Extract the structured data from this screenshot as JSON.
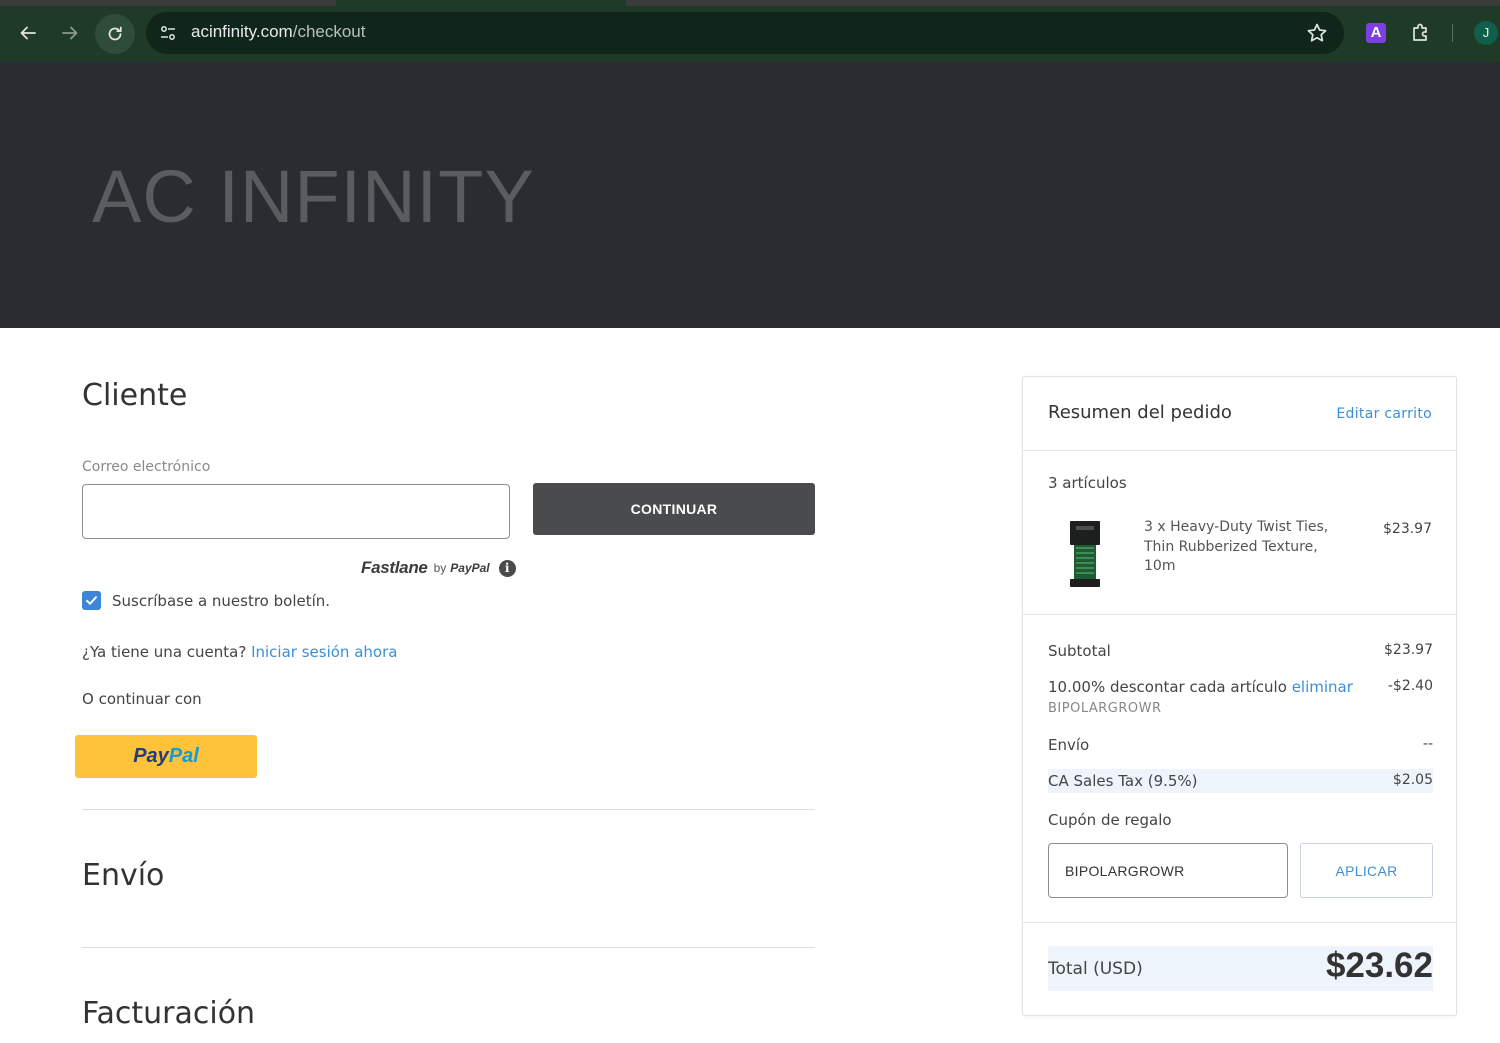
{
  "browser": {
    "url_domain": "acinfinity.com",
    "url_path": "/checkout",
    "profile_initial": "J",
    "extension_label": "A"
  },
  "header": {
    "logo": "AC INFINITY"
  },
  "customer": {
    "title": "Cliente",
    "email_label": "Correo electrónico",
    "email_value": "",
    "continue_label": "CONTINUAR",
    "fastlane": {
      "brand": "Fastlane",
      "by": "by",
      "paypal": "PayPal"
    },
    "newsletter_label": "Suscríbase a nuestro boletín.",
    "newsletter_checked": true,
    "account_prompt": "¿Ya tiene una cuenta?",
    "signin_link": "Iniciar sesión ahora",
    "or_continue": "O continuar con",
    "paypal_button": {
      "pay": "Pay",
      "pal": "Pal"
    }
  },
  "sections": {
    "shipping": "Envío",
    "billing": "Facturación"
  },
  "summary": {
    "title": "Resumen del pedido",
    "edit_cart": "Editar carrito",
    "item_count": "3 artículos",
    "items": [
      {
        "name": "3 x Heavy-Duty Twist Ties, Thin Rubberized Texture, 10m",
        "price": "$23.97"
      }
    ],
    "subtotal_label": "Subtotal",
    "subtotal_value": "$23.97",
    "discount_label": "10.00% descontar cada artículo",
    "discount_remove": "eliminar",
    "discount_value": "-$2.40",
    "discount_code": "BIPOLARGROWR",
    "shipping_label": "Envío",
    "shipping_value": "--",
    "tax_label": "CA Sales Tax (9.5%)",
    "tax_value": "$2.05",
    "coupon_label": "Cupón de regalo",
    "coupon_value": "BIPOLARGROWR",
    "apply_label": "APLICAR",
    "total_label": "Total (USD)",
    "total_value": "$23.62"
  },
  "colors": {
    "accent": "#3b8fd9",
    "header_bg": "#2b2c31",
    "paypal_yellow": "#fec33a",
    "checkbox": "#3a86d8"
  }
}
